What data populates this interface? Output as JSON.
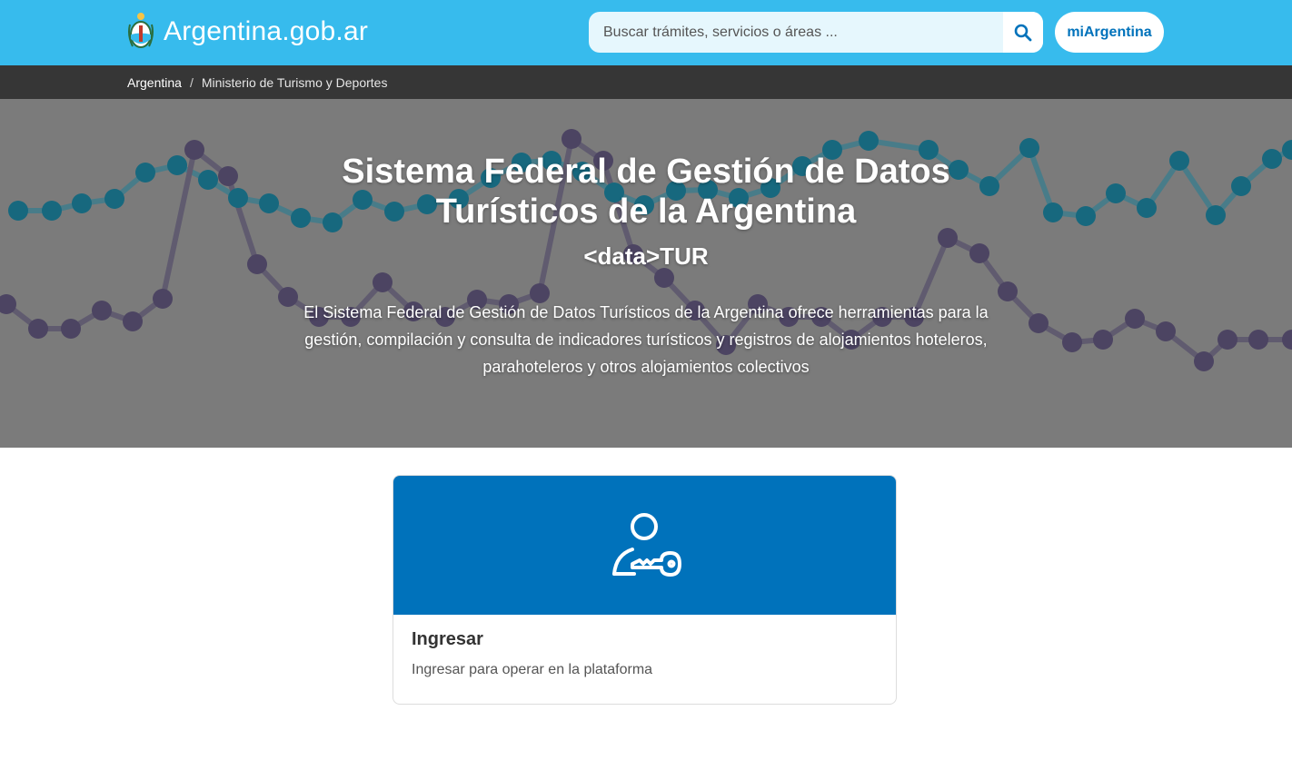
{
  "header": {
    "brand": "Argentina.gob.ar",
    "search_placeholder": "Buscar trámites, servicios o áreas ...",
    "mi_argentina": "miArgentina"
  },
  "breadcrumb": {
    "items": [
      "Argentina",
      "Ministerio de Turismo y Deportes"
    ],
    "separator": "/"
  },
  "hero": {
    "title": "Sistema Federal de Gestión de Datos Turísticos de la Argentina",
    "subtitle": "<data>TUR",
    "description": "El Sistema Federal de Gestión de Datos Turísticos de la Argentina ofrece herramientas para la gestión, compilación y consulta de indicadores turísticos y registros de alojamientos hoteleros, parahoteleros y otros alojamientos colectivos"
  },
  "card": {
    "icon": "user-key-icon",
    "title": "Ingresar",
    "description": "Ingresar para operar en la plataforma"
  },
  "colors": {
    "header_bg": "#37bbed",
    "breadcrumb_bg": "#363636",
    "hero_bg": "#7b7b7b",
    "card_accent": "#0072bb",
    "teal_series": "#17687e",
    "purple_series": "#4c4462"
  }
}
